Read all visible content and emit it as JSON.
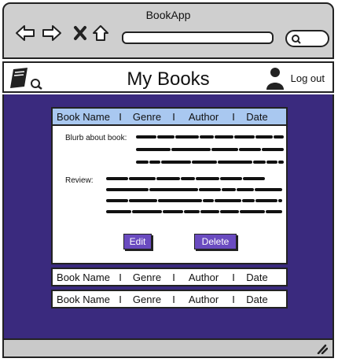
{
  "browser": {
    "title": "BookApp"
  },
  "header": {
    "title": "My Books",
    "logout_label": "Log out"
  },
  "columns": [
    "Book Name",
    "Genre",
    "Author",
    "Date"
  ],
  "separator": "I",
  "books": [
    {
      "name": "Book Name",
      "genre": "Genre",
      "author": "Author",
      "date": "Date",
      "expanded": true
    },
    {
      "name": "Book Name",
      "genre": "Genre",
      "author": "Author",
      "date": "Date",
      "expanded": false
    },
    {
      "name": "Book Name",
      "genre": "Genre",
      "author": "Author",
      "date": "Date",
      "expanded": false
    }
  ],
  "detail": {
    "blurb_label": "Blurb about book:",
    "review_label": "Review:",
    "edit_label": "Edit",
    "delete_label": "Delete"
  },
  "colors": {
    "background": "#3a2a7e",
    "active_row": "#a9c8f0",
    "button": "#6a4bc0",
    "chrome": "#cfcfcf"
  }
}
